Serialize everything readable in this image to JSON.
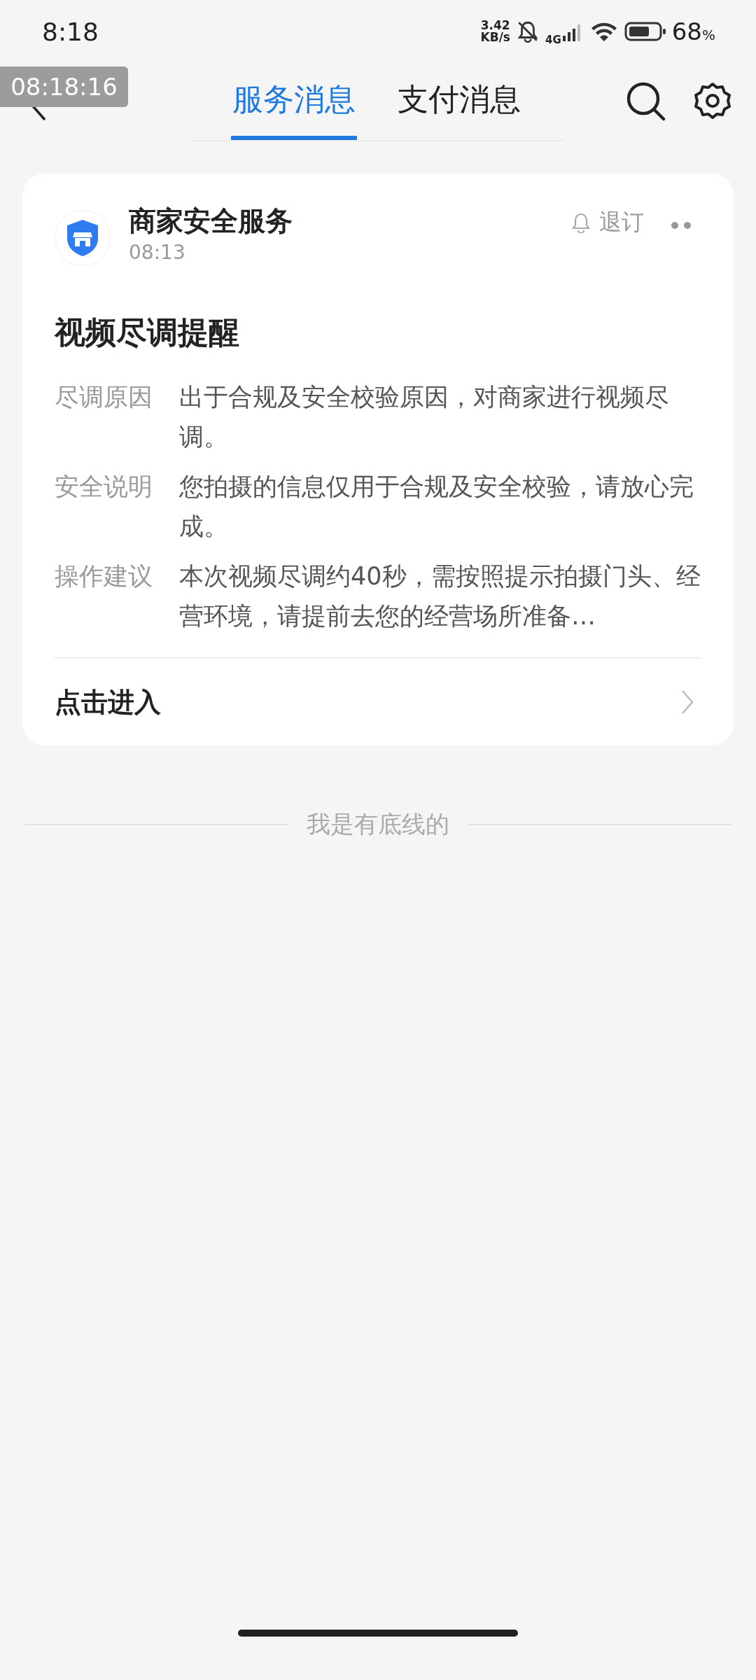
{
  "status_bar": {
    "time": "8:18",
    "net_speed_value": "3.42",
    "net_speed_unit": "KB/s",
    "network": "4G",
    "battery": "68",
    "battery_unit": "%"
  },
  "recording_timestamp": "08:18:16",
  "tabs": [
    {
      "label": "服务消息",
      "selected": true
    },
    {
      "label": "支付消息",
      "selected": false
    }
  ],
  "message": {
    "sender": "商家安全服务",
    "time": "08:13",
    "unsubscribe": "退订",
    "title": "视频尽调提醒",
    "fields": [
      {
        "label": "尽调原因",
        "value": "出于合规及安全校验原因，对商家进行视频尽调。"
      },
      {
        "label": "安全说明",
        "value": "您拍摄的信息仅用于合规及安全校验，请放心完成。"
      },
      {
        "label": "操作建议",
        "value": "本次视频尽调约40秒，需按照提示拍摄门头、经营环境，请提前去您的经营场所准备…"
      }
    ],
    "action": "点击进入"
  },
  "footer": "我是有底线的"
}
